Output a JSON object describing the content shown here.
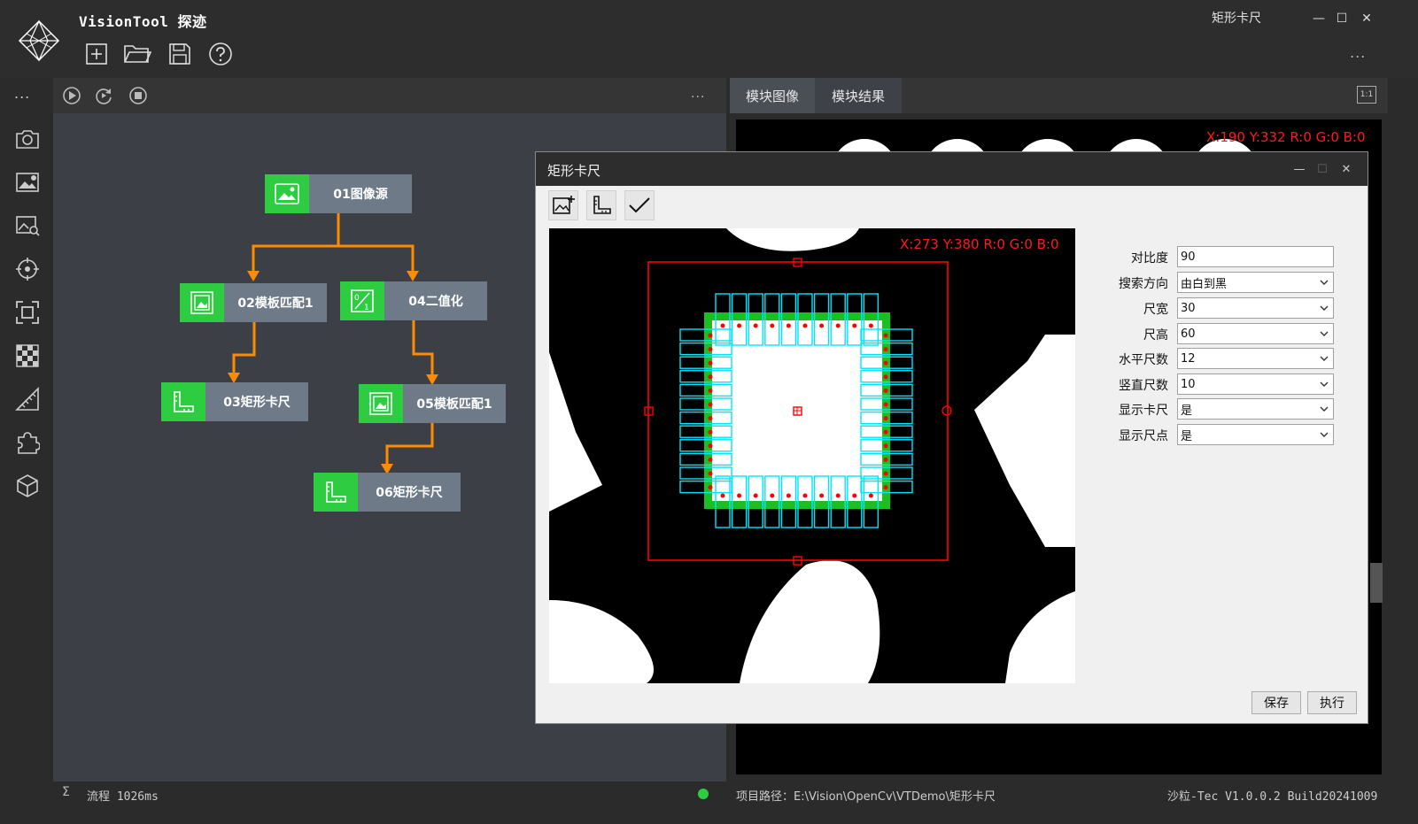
{
  "app": {
    "title": "VisionTool 探迹",
    "window_title": "矩形卡尺",
    "more": "...",
    "win_controls": {
      "minimize": "—",
      "maximize": "☐",
      "close": "✕"
    }
  },
  "toolbar": [
    "new-file-icon",
    "open-folder-icon",
    "save-icon",
    "help-icon"
  ],
  "leftnav": {
    "more": "...",
    "items": [
      "camera-icon",
      "image-edit-icon",
      "image-search-icon",
      "target-icon",
      "focus-icon",
      "checker-icon",
      "measure-icon",
      "plugin-icon",
      "cube-icon"
    ]
  },
  "flow": {
    "more": "...",
    "nodes": [
      {
        "label": "01图像源",
        "icon": "image-icon"
      },
      {
        "label": "02模板匹配1",
        "icon": "template-icon"
      },
      {
        "label": "04二值化",
        "icon": "binary-icon"
      },
      {
        "label": "03矩形卡尺",
        "icon": "ruler-icon"
      },
      {
        "label": "05模板匹配1",
        "icon": "template-icon"
      },
      {
        "label": "06矩形卡尺",
        "icon": "ruler-icon"
      }
    ],
    "status": {
      "sigma": "Σ",
      "time": "流程 1026ms",
      "ok_color": "#2ecc40"
    }
  },
  "right": {
    "tabs": [
      {
        "label": "模块图像"
      },
      {
        "label": "模块结果"
      }
    ],
    "one_to_one": "1:1",
    "coord": "X:190 Y:332  R:0 G:0 B:0",
    "project_path": "项目路径：E:\\Vision\\OpenCv\\VTDemo\\矩形卡尺",
    "version": "沙粒-Tec V1.0.0.2 Build20241009"
  },
  "dialog": {
    "title": "矩形卡尺",
    "tools": [
      "add-image-icon",
      "ruler-icon",
      "check-icon"
    ],
    "coord": "X:273 Y:380  R:0 G:0 B:0",
    "props": [
      {
        "label": "对比度",
        "value": "90",
        "type": "text"
      },
      {
        "label": "搜索方向",
        "value": "由白到黑",
        "type": "select"
      },
      {
        "label": "尺宽",
        "value": "30",
        "type": "select"
      },
      {
        "label": "尺高",
        "value": "60",
        "type": "select"
      },
      {
        "label": "水平尺数",
        "value": "12",
        "type": "select"
      },
      {
        "label": "竖直尺数",
        "value": "10",
        "type": "select"
      },
      {
        "label": "显示卡尺",
        "value": "是",
        "type": "select"
      },
      {
        "label": "显示尺点",
        "value": "是",
        "type": "select"
      }
    ],
    "buttons": {
      "save": "保存",
      "run": "执行"
    }
  },
  "colors": {
    "accent_green": "#2ecc40",
    "node_gray": "#6e7a88",
    "edge_orange": "#ff8c00",
    "roi_red": "#ff0000",
    "caliper_cyan": "#00e5ff"
  }
}
